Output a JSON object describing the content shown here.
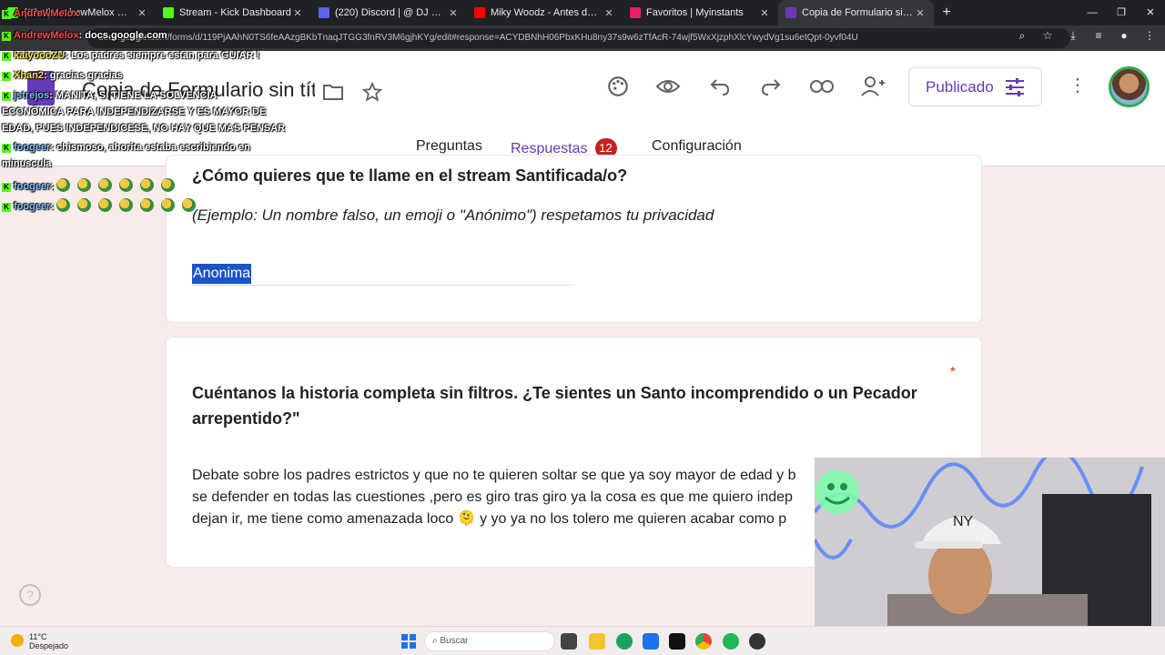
{
  "browser": {
    "tabs": [
      {
        "title": "(Chat) AndrewMelox — Stream - Watch Live o",
        "active": false,
        "favicon_color": "#53fc18"
      },
      {
        "title": "Stream - Kick Dashboard",
        "active": false,
        "favicon_color": "#53fc18"
      },
      {
        "title": "(220) Discord | @ DJ SANRO",
        "active": false,
        "favicon_color": "#5865f2"
      },
      {
        "title": "Miky Woodz - Antes de Mo",
        "active": false,
        "favicon_color": "#ff0000"
      },
      {
        "title": "Favoritos | Myinstants",
        "active": false,
        "favicon_color": "#e91e63"
      },
      {
        "title": "Copia de Formulario sin título",
        "active": true,
        "favicon_color": "#673ab7"
      }
    ],
    "new_tab": "+",
    "url": "docs.google.com/forms/d/119PjAAhN0TS6feAAzgBKbTnaqJTGG3fnRV3M6gjhKYg/edit#response=ACYDBNhH06PbxKHu8ny37s9w6zTfAcR-74wjf5WxXjzphXlcYwydVg1su6etQpt-0yvf04U"
  },
  "forms": {
    "title": "Copia de Formulario sin título",
    "publish_label": "Publicado",
    "tabs": {
      "preguntas": "Preguntas",
      "respuestas": "Respuestas",
      "respuestas_count": "12",
      "configuracion": "Configuración"
    }
  },
  "card1": {
    "question": "¿Cómo quieres que te llame en el stream Santificada/o?",
    "description": "(Ejemplo: Un nombre falso, un emoji o \"Anónimo\") respetamos tu privacidad",
    "answer": "Anonima"
  },
  "card2": {
    "required_mark": "*",
    "question_line1": "Cuéntanos la historia completa sin filtros. ¿Te sientes un Santo incomprendido o un Pecador",
    "question_line2": "arrepentido?\"",
    "answer_line1": "Debate sobre los padres estrictos y que no te quieren soltar se que ya soy mayor de edad y b",
    "answer_line2": "se defender en todas las cuestiones ,pero es giro tras giro ya la cosa es que me quiero indep",
    "answer_line3": "dejan ir, me tiene como amenazada loco 🫠 y yo ya no los tolero me quieren acabar como p"
  },
  "chat": [
    {
      "user": "AndrewMelox",
      "msg": "",
      "color": "red"
    },
    {
      "user": "AndrewMelox",
      "msg": ": docs.google.com",
      "color": "red"
    },
    {
      "user": "kaiyoooZU",
      "msg": ": Los padres siempre estan para GUIAR !",
      "color": "yel"
    },
    {
      "user": "Xhan2",
      "msg": ": gracias gracias",
      "color": "yel"
    },
    {
      "user": "jstrejos",
      "msg": ": MANITA, SI TIENE LA SOLVENCIA",
      "color": "blue"
    },
    {
      "user": "",
      "msg": "ECONÓMICA PARA INDEPENDIZARSE Y ES MAYOR DE",
      "color": "blue"
    },
    {
      "user": "",
      "msg": "EDAD, PUES INDEPENDICESE, NO HAY QUE MAS PENSAR",
      "color": "blue"
    },
    {
      "user": "foogeer",
      "msg": ": chismoso, ahorita estaba escribiendo en",
      "color": "blue"
    },
    {
      "user": "",
      "msg": "minuscula",
      "color": "blue"
    },
    {
      "user": "foogeer",
      "msg": ":",
      "color": "blue"
    },
    {
      "user": "foogeer",
      "msg": ":",
      "color": "blue"
    }
  ],
  "taskbar": {
    "temp": "11°C",
    "weather": "Despejado",
    "search_placeholder": "Buscar"
  },
  "help_label": "?"
}
